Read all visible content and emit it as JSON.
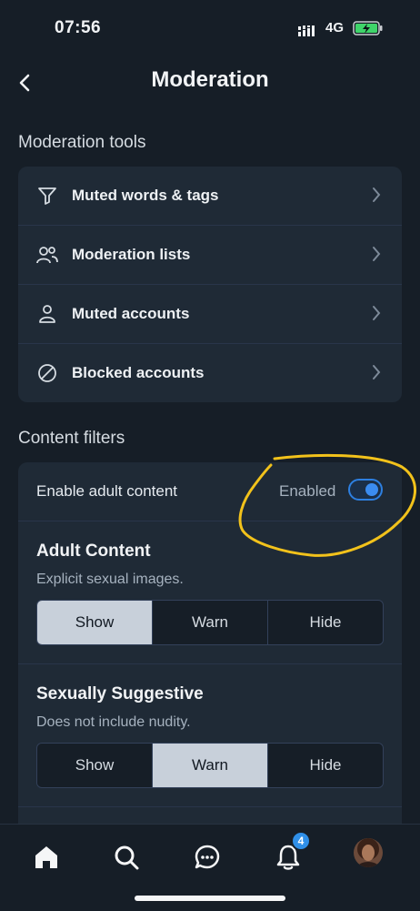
{
  "status_bar": {
    "time": "07:56",
    "network": "4G",
    "battery_icon": "battery-charging-icon",
    "signal_icon": "signal-icon"
  },
  "header": {
    "title": "Moderation",
    "back_icon": "chevron-left-icon"
  },
  "moderation_tools": {
    "heading": "Moderation tools",
    "items": [
      {
        "label": "Muted words & tags",
        "icon": "filter-icon"
      },
      {
        "label": "Moderation lists",
        "icon": "users-icon"
      },
      {
        "label": "Muted accounts",
        "icon": "person-icon"
      },
      {
        "label": "Blocked accounts",
        "icon": "block-icon"
      }
    ]
  },
  "content_filters": {
    "heading": "Content filters",
    "adult_content": {
      "label": "Enable adult content",
      "state_label": "Enabled",
      "enabled": true
    },
    "prefs": [
      {
        "title": "Adult Content",
        "description": "Explicit sexual images.",
        "options": [
          "Show",
          "Warn",
          "Hide"
        ],
        "selected": "Show"
      },
      {
        "title": "Sexually Suggestive",
        "description": "Does not include nudity.",
        "options": [
          "Show",
          "Warn",
          "Hide"
        ],
        "selected": "Warn"
      }
    ]
  },
  "tab_bar": {
    "tabs": [
      "home-icon",
      "search-icon",
      "chat-icon",
      "bell-icon",
      "profile-avatar"
    ],
    "notification_badge": "4"
  },
  "colors": {
    "background": "#161e27",
    "card": "#1f2a36",
    "accent": "#3b8cf0",
    "annotation": "#f2c21b",
    "selected_segment": "#c8d0da"
  }
}
